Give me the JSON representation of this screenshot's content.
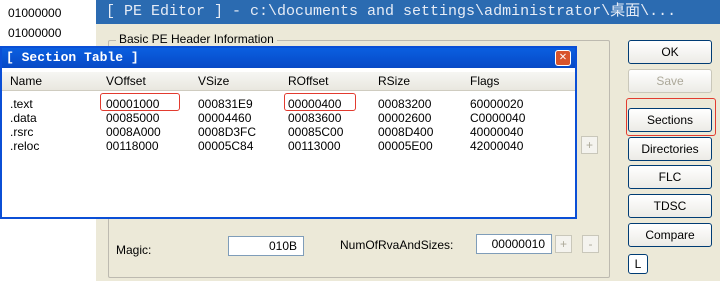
{
  "left_column": {
    "values": [
      "01000000",
      "01000000"
    ]
  },
  "pe_editor": {
    "title": "[ PE Editor ] - c:\\documents and settings\\administrator\\桌面\\..."
  },
  "basic_header": {
    "group_label": "Basic PE Header Information",
    "magic_label": "Magic:",
    "magic_value": "010B",
    "num_rva_label": "NumOfRvaAndSizes:",
    "num_rva_value": "00000010"
  },
  "buttons": {
    "ok": "OK",
    "save": "Save",
    "sections": "Sections",
    "directories": "Directories",
    "flc": "FLC",
    "tdsc": "TDSC",
    "compare": "Compare",
    "l": "L"
  },
  "spin": {
    "plus": "+",
    "minus": "-"
  },
  "section_table": {
    "title": "[ Section Table ]",
    "close_icon": "close-icon",
    "columns": [
      "Name",
      "VOffset",
      "VSize",
      "ROffset",
      "RSize",
      "Flags"
    ],
    "rows": [
      [
        ".text",
        "00001000",
        "000831E9",
        "00000400",
        "00083200",
        "60000020"
      ],
      [
        ".data",
        "00085000",
        "00004460",
        "00083600",
        "00002600",
        "C0000040"
      ],
      [
        ".rsrc",
        "0008A000",
        "0008D3FC",
        "00085C00",
        "0008D400",
        "40000040"
      ],
      [
        ".reloc",
        "00118000",
        "00005C84",
        "00113000",
        "00005E00",
        "42000040"
      ]
    ]
  },
  "colors": {
    "highlight": "#e23b2f",
    "title_bar": "#0a5fe0",
    "pe_title_bar": "#2b6bb1"
  }
}
